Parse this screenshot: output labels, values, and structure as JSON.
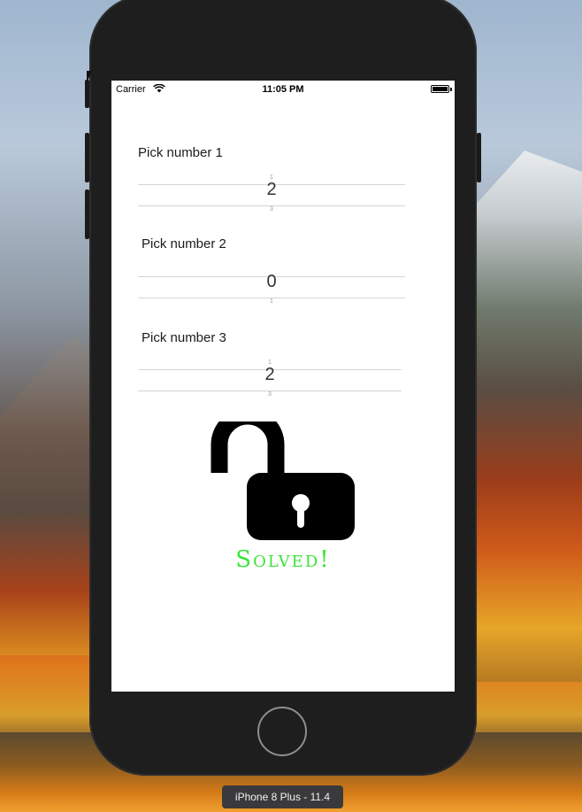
{
  "status_bar": {
    "carrier": "Carrier",
    "time": "11:05 PM",
    "wifi_icon": "wifi-icon",
    "battery_icon": "battery-icon"
  },
  "pickers": [
    {
      "label": "Pick number 1",
      "value": "2"
    },
    {
      "label": "Pick number 2",
      "value": "0"
    },
    {
      "label": "Pick number 3",
      "value": "2"
    }
  ],
  "lock": {
    "icon": "unlocked-padlock-icon",
    "status": "Solved!",
    "status_color": "#39e639"
  },
  "simulator": {
    "device_label": "iPhone 8 Plus - 11.4"
  }
}
